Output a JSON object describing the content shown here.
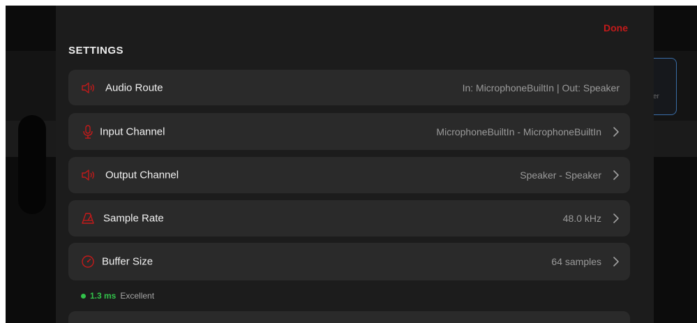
{
  "header": {
    "done_label": "Done",
    "title": "SETTINGS"
  },
  "rows": [
    {
      "label": "Audio Route",
      "value": "In: MicrophoneBuiltIn | Out: Speaker",
      "icon": "speaker-icon"
    },
    {
      "label": "Input Channel",
      "value": "MicrophoneBuiltIn - MicrophoneBuiltIn",
      "icon": "microphone-icon"
    },
    {
      "label": "Output Channel",
      "value": "Speaker - Speaker",
      "icon": "speaker-icon"
    },
    {
      "label": "Sample Rate",
      "value": "48.0 kHz",
      "icon": "metronome-icon"
    },
    {
      "label": "Buffer Size",
      "value": "64 samples",
      "icon": "gauge-icon"
    }
  ],
  "latency": {
    "value": "1.3 ms",
    "quality": "Excellent"
  },
  "background": {
    "card_text": "er"
  },
  "colors": {
    "accent": "#c41a1a",
    "status_good": "#32c24a",
    "row_bg": "#2a2a2a",
    "sheet_bg": "#1c1c1c"
  }
}
